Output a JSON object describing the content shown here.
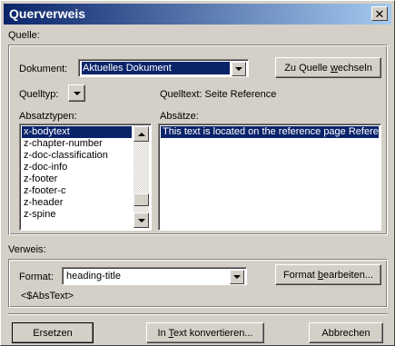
{
  "window": {
    "title": "Querverweis"
  },
  "quelle": {
    "heading": "Quelle:",
    "dokument_label": "Dokument:",
    "dokument_value": "Aktuelles Dokument",
    "switch_button": {
      "pre": "Zu Quelle ",
      "key": "w",
      "post": "echseln"
    },
    "quelltyp_label": "Quelltyp:",
    "quelltext_label": "Quelltext: Seite",
    "quelltext_value": "Reference",
    "absatztypen_label": "Absatztypen:",
    "absatztypen_items": [
      "x-bodytext",
      "z-chapter-number",
      "z-doc-classification",
      "z-doc-info",
      "z-footer",
      "z-footer-c",
      "z-header",
      "z-spine"
    ],
    "absatztypen_selected": "x-bodytext",
    "absaetze_label": "Absätze:",
    "absaetze_items": [
      "This text is located on the reference page Reference"
    ]
  },
  "verweis": {
    "heading": "Verweis:",
    "format_label": "Format:",
    "format_value": "heading-title",
    "format_edit_button": {
      "pre": "Format ",
      "key": "b",
      "post": "earbeiten..."
    },
    "format_code": "<$AbsText>"
  },
  "buttons": {
    "replace": "Ersetzen",
    "convert": {
      "pre": "In ",
      "key": "T",
      "post": "ext konvertieren..."
    },
    "cancel": "Abbrechen"
  },
  "colors": {
    "face": "#d4d0c8",
    "selection": "#0a246a",
    "title_gradient_start": "#0a246a",
    "title_gradient_end": "#a6caf0"
  }
}
